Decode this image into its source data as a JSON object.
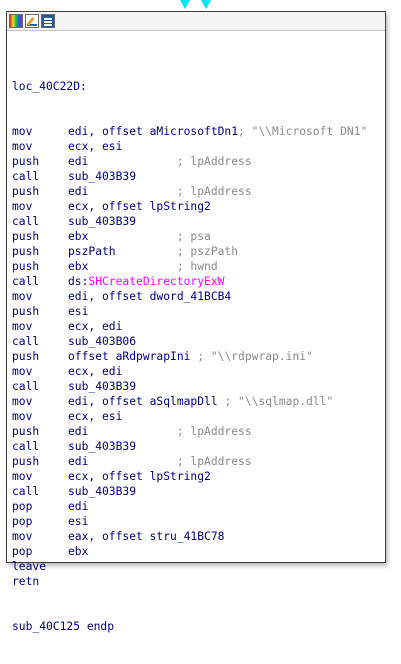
{
  "node": {
    "label": "loc_40C22D:",
    "lines": [
      {
        "mn": "mov",
        "op": "edi, offset aMicrosoftDn1",
        "cmt": "; \"\\\\Microsoft DN1\""
      },
      {
        "mn": "mov",
        "op": "ecx, esi",
        "cmt": ""
      },
      {
        "mn": "push",
        "op": "edi             ",
        "cmt": "; lpAddress"
      },
      {
        "mn": "call",
        "op": "sub_403B39",
        "cmt": ""
      },
      {
        "mn": "push",
        "op": "edi             ",
        "cmt": "; lpAddress"
      },
      {
        "mn": "mov",
        "op": "ecx, offset lpString2",
        "cmt": ""
      },
      {
        "mn": "call",
        "op": "sub_403B39",
        "cmt": ""
      },
      {
        "mn": "push",
        "op": "ebx             ",
        "cmt": "; psa"
      },
      {
        "mn": "push",
        "op": "pszPath         ",
        "cmt": "; pszPath"
      },
      {
        "mn": "push",
        "op": "ebx             ",
        "cmt": "; hwnd"
      },
      {
        "mn": "call",
        "op": "ds:",
        "imp": "SHCreateDirectoryExW",
        "cmt": ""
      },
      {
        "mn": "mov",
        "op": "edi, offset dword_41BCB4",
        "cmt": ""
      },
      {
        "mn": "push",
        "op": "esi",
        "cmt": ""
      },
      {
        "mn": "mov",
        "op": "ecx, edi",
        "cmt": ""
      },
      {
        "mn": "call",
        "op": "sub_403B06",
        "cmt": ""
      },
      {
        "mn": "push",
        "op": "offset aRdpwrapIni ",
        "cmt": "; \"\\\\rdpwrap.ini\""
      },
      {
        "mn": "mov",
        "op": "ecx, edi",
        "cmt": ""
      },
      {
        "mn": "call",
        "op": "sub_403B39",
        "cmt": ""
      },
      {
        "mn": "mov",
        "op": "edi, offset aSqlmapDll ",
        "cmt": "; \"\\\\sqlmap.dll\""
      },
      {
        "mn": "mov",
        "op": "ecx, esi",
        "cmt": ""
      },
      {
        "mn": "push",
        "op": "edi             ",
        "cmt": "; lpAddress"
      },
      {
        "mn": "call",
        "op": "sub_403B39",
        "cmt": ""
      },
      {
        "mn": "push",
        "op": "edi             ",
        "cmt": "; lpAddress"
      },
      {
        "mn": "mov",
        "op": "ecx, offset lpString2",
        "cmt": ""
      },
      {
        "mn": "call",
        "op": "sub_403B39",
        "cmt": ""
      },
      {
        "mn": "pop",
        "op": "edi",
        "cmt": ""
      },
      {
        "mn": "pop",
        "op": "esi",
        "cmt": ""
      },
      {
        "mn": "mov",
        "op": "eax, offset stru_41BC78",
        "cmt": ""
      },
      {
        "mn": "pop",
        "op": "ebx",
        "cmt": ""
      },
      {
        "mn": "leave",
        "op": "",
        "cmt": ""
      },
      {
        "mn": "retn",
        "op": "",
        "cmt": ""
      }
    ],
    "end": "sub_40C125 endp"
  },
  "icons": [
    "color-palette-icon",
    "edit-icon",
    "graph-overview-icon",
    "incoming-edge-arrow"
  ],
  "colors": {
    "code": "#000080",
    "comment": "#8a8a8a",
    "import": "#ff00ff",
    "edge": "#00e5ee",
    "border": "#404040"
  }
}
